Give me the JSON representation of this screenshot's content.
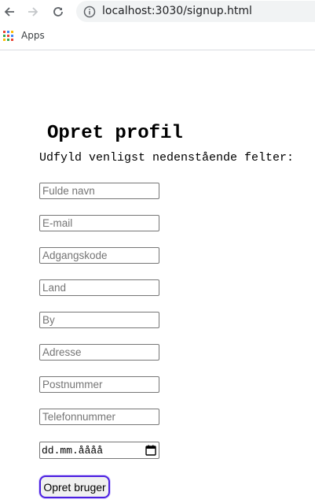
{
  "browser": {
    "url": "localhost:3030/signup.html",
    "bookmarks": {
      "apps_label": "Apps"
    }
  },
  "page": {
    "title": "Opret profil",
    "intro": "Udfyld venligst nedenstående felter:"
  },
  "form": {
    "fields": [
      {
        "placeholder": "Fulde navn",
        "value": ""
      },
      {
        "placeholder": "E-mail",
        "value": ""
      },
      {
        "placeholder": "Adgangskode",
        "value": ""
      },
      {
        "placeholder": "Land",
        "value": ""
      },
      {
        "placeholder": "By",
        "value": ""
      },
      {
        "placeholder": "Adresse",
        "value": ""
      },
      {
        "placeholder": "Postnummer",
        "value": ""
      },
      {
        "placeholder": "Telefonnummer",
        "value": ""
      }
    ],
    "date_placeholder": "dd.mm.åååå",
    "submit_label": "Opret bruger"
  }
}
